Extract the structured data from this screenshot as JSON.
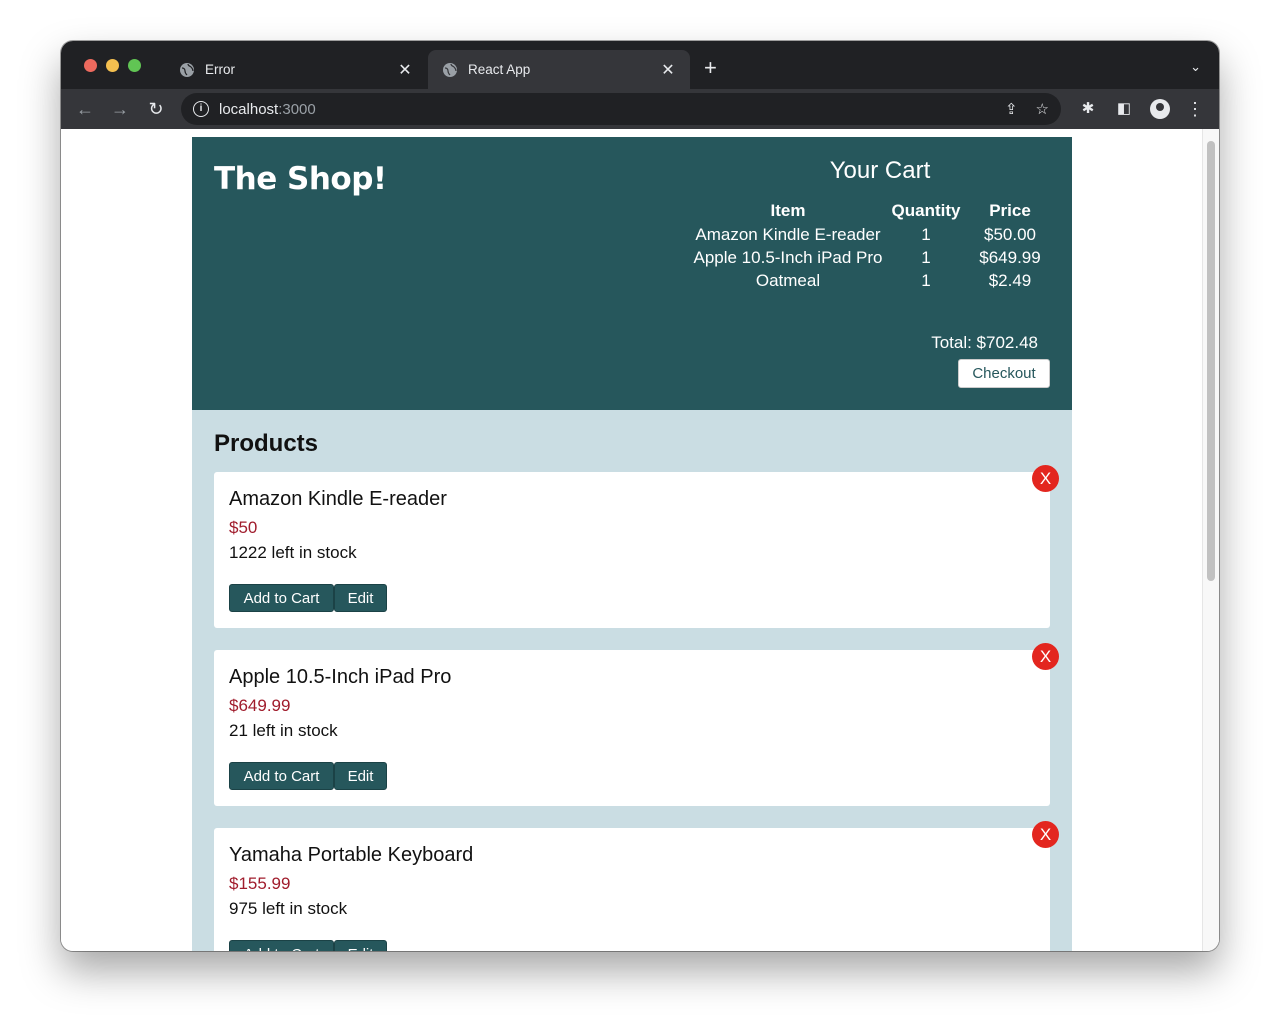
{
  "browser": {
    "tabs": [
      {
        "title": "Error",
        "close": "✕"
      },
      {
        "title": "React App",
        "close": "✕"
      }
    ],
    "new_tab": "+",
    "tab_menu": "⌄",
    "nav": {
      "back": "←",
      "forward": "→",
      "reload": "↻"
    },
    "url": {
      "host": "localhost",
      "port": ":3000"
    },
    "icons": {
      "share": "⇪",
      "bookmark": "☆",
      "extensions": "✱",
      "sidebar": "◧",
      "menu": "⋮"
    }
  },
  "header": {
    "logo": "The Shop!",
    "cart": {
      "title": "Your Cart",
      "columns": [
        "Item",
        "Quantity",
        "Price"
      ],
      "rows": [
        {
          "item": "Amazon Kindle E-reader",
          "quantity": "1",
          "price": "$50.00"
        },
        {
          "item": "Apple 10.5-Inch iPad Pro",
          "quantity": "1",
          "price": "$649.99"
        },
        {
          "item": "Oatmeal",
          "quantity": "1",
          "price": "$2.49"
        }
      ],
      "total": "Total: $702.48",
      "checkout_label": "Checkout"
    }
  },
  "products": {
    "title": "Products",
    "items": [
      {
        "name": "Amazon Kindle E-reader",
        "price": "$50",
        "stock": "1222 left in stock",
        "add_label": "Add to Cart",
        "edit_label": "Edit",
        "delete_label": "X"
      },
      {
        "name": "Apple 10.5-Inch iPad Pro",
        "price": "$649.99",
        "stock": "21 left in stock",
        "add_label": "Add to Cart",
        "edit_label": "Edit",
        "delete_label": "X"
      },
      {
        "name": "Yamaha Portable Keyboard",
        "price": "$155.99",
        "stock": "975 left in stock",
        "add_label": "Add to Cart",
        "edit_label": "Edit",
        "delete_label": "X"
      }
    ]
  },
  "colors": {
    "header_bg": "#26575c",
    "page_bg": "#cadde3",
    "price": "#a01c2c",
    "delete": "#e3261f"
  }
}
